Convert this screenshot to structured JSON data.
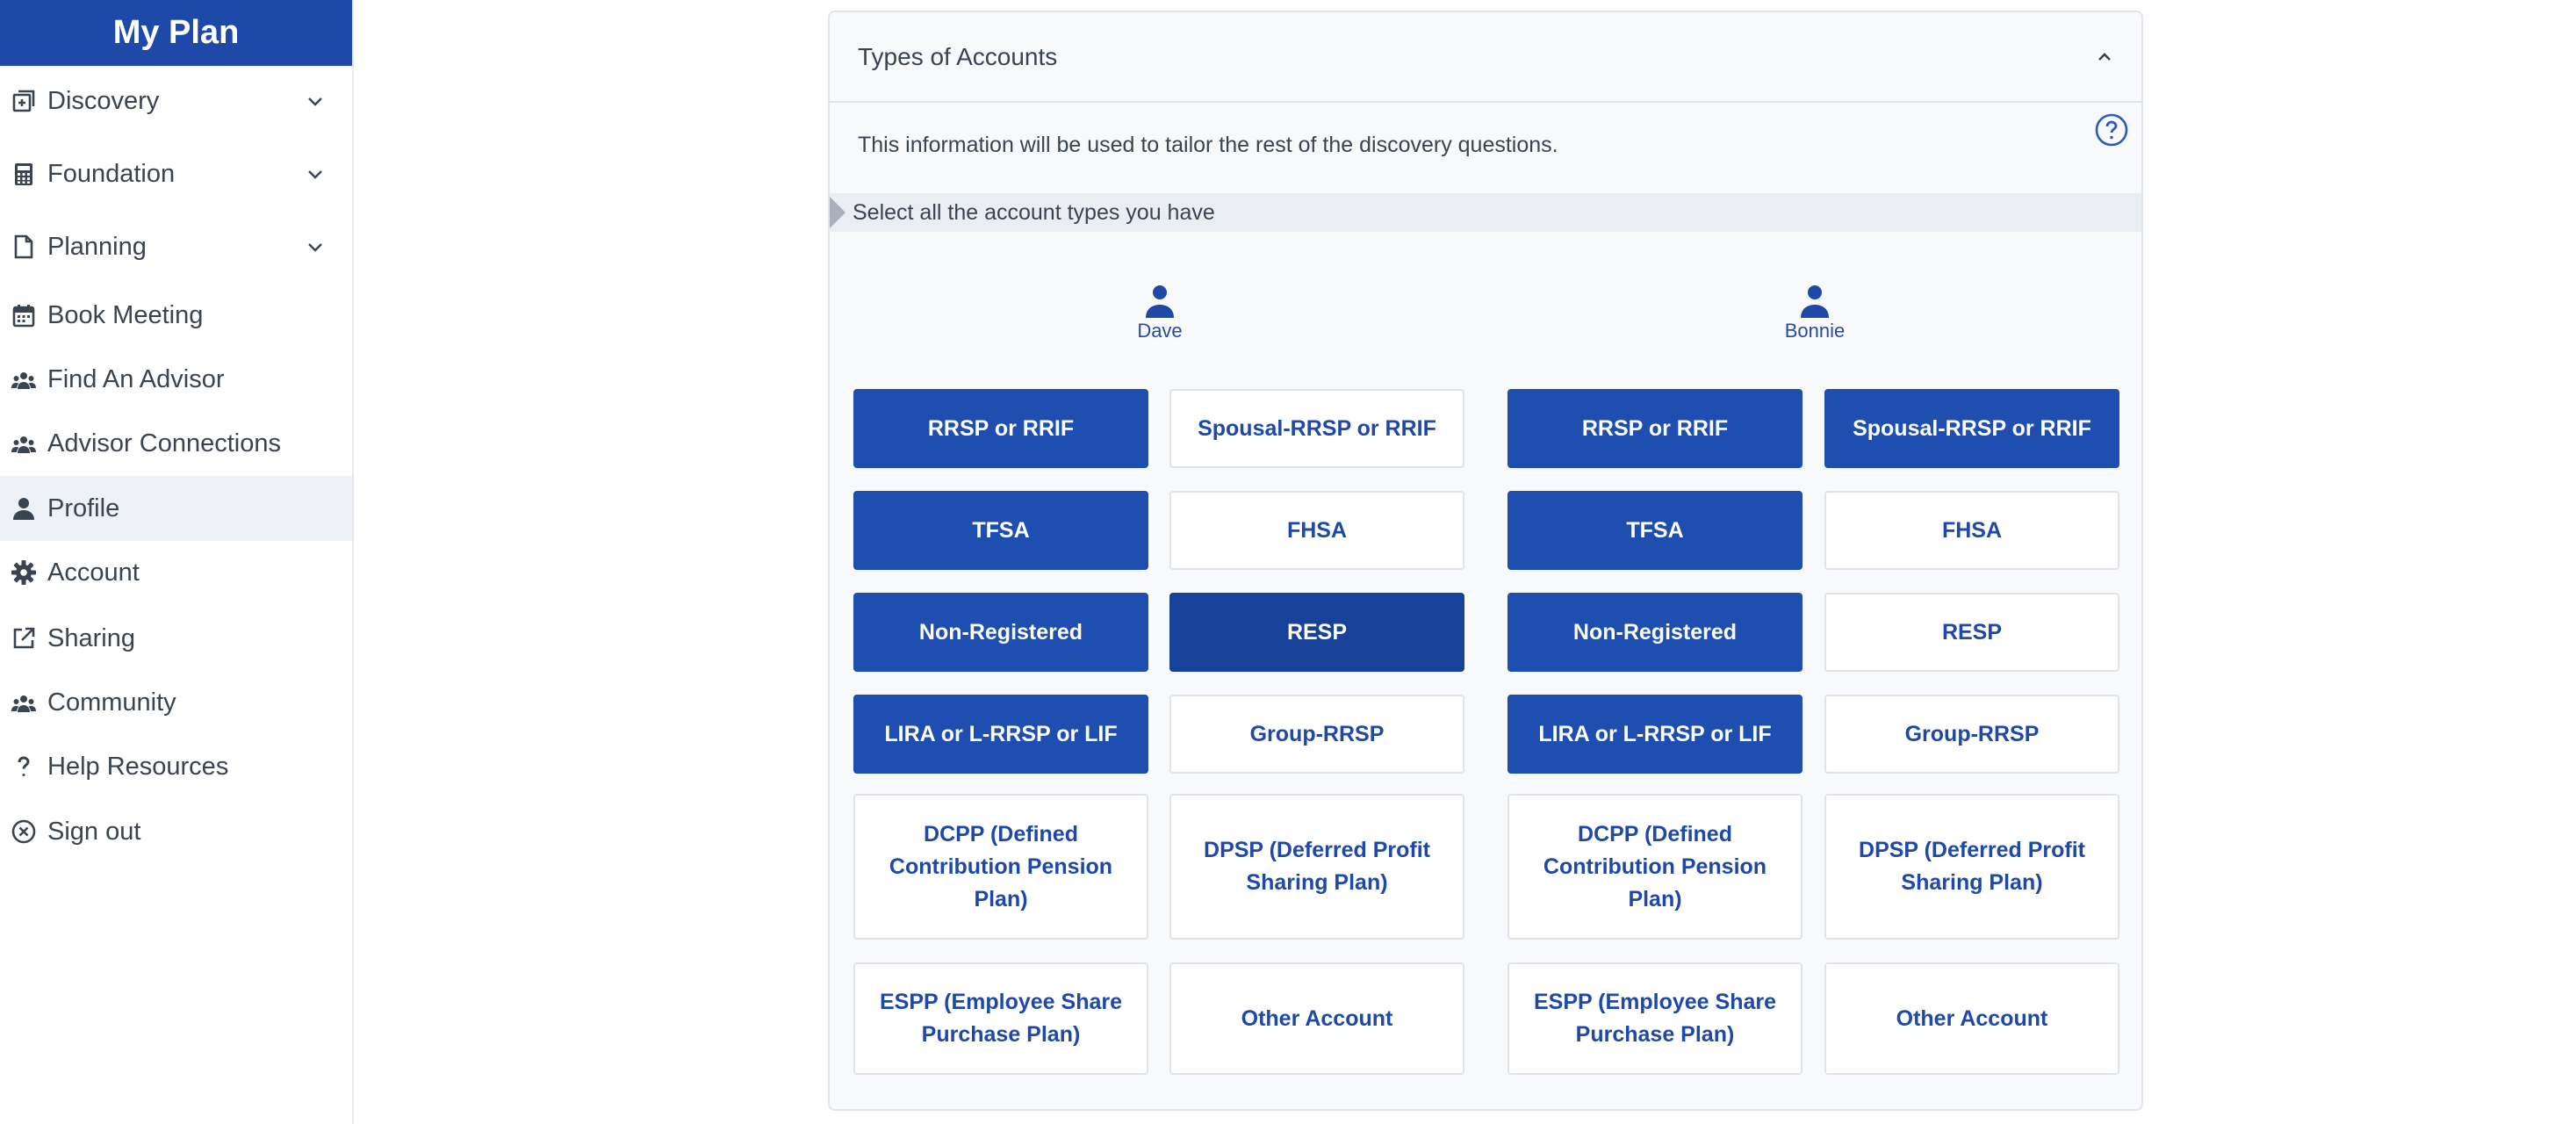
{
  "app": {
    "title": "My Plan"
  },
  "sidebar": {
    "items": [
      {
        "label": "Discovery",
        "icon": "discovery-icon",
        "expandable": true
      },
      {
        "label": "Foundation",
        "icon": "calculator-icon",
        "expandable": true
      },
      {
        "label": "Planning",
        "icon": "document-icon",
        "expandable": true
      },
      {
        "label": "Book Meeting",
        "icon": "calendar-icon",
        "expandable": false
      },
      {
        "label": "Find An Advisor",
        "icon": "group-icon",
        "expandable": false
      },
      {
        "label": "Advisor Connections",
        "icon": "group-icon",
        "expandable": false
      },
      {
        "label": "Profile",
        "icon": "user-icon",
        "expandable": false,
        "active": true
      },
      {
        "label": "Account",
        "icon": "gear-icon",
        "expandable": false
      },
      {
        "label": "Sharing",
        "icon": "external-link-icon",
        "expandable": false
      },
      {
        "label": "Community",
        "icon": "group-icon",
        "expandable": false
      },
      {
        "label": "Help Resources",
        "icon": "question-icon",
        "expandable": false
      },
      {
        "label": "Sign out",
        "icon": "close-circle-icon",
        "expandable": false
      }
    ]
  },
  "card": {
    "title": "Types of Accounts",
    "intro": "This information will be used to tailor the rest of the discovery questions.",
    "prompt": "Select all the account types you have"
  },
  "people": [
    {
      "name": "Dave",
      "accounts": [
        {
          "label": "RRSP or RRIF",
          "selected": true
        },
        {
          "label": "Spousal-RRSP or RRIF",
          "selected": false
        },
        {
          "label": "TFSA",
          "selected": true
        },
        {
          "label": "FHSA",
          "selected": false
        },
        {
          "label": "Non-Registered",
          "selected": true
        },
        {
          "label": "RESP",
          "selected": true,
          "focused": true
        },
        {
          "label": "LIRA or L-RRSP or LIF",
          "selected": true
        },
        {
          "label": "Group-RRSP",
          "selected": false
        },
        {
          "label": "DCPP (Defined Contribution Pension Plan)",
          "selected": false
        },
        {
          "label": "DPSP (Deferred Profit Sharing Plan)",
          "selected": false
        },
        {
          "label": "ESPP (Employee Share Purchase Plan)",
          "selected": false
        },
        {
          "label": "Other Account",
          "selected": false
        }
      ]
    },
    {
      "name": "Bonnie",
      "accounts": [
        {
          "label": "RRSP or RRIF",
          "selected": true
        },
        {
          "label": "Spousal-RRSP or RRIF",
          "selected": true
        },
        {
          "label": "TFSA",
          "selected": true
        },
        {
          "label": "FHSA",
          "selected": false
        },
        {
          "label": "Non-Registered",
          "selected": true
        },
        {
          "label": "RESP",
          "selected": false
        },
        {
          "label": "LIRA or L-RRSP or LIF",
          "selected": true
        },
        {
          "label": "Group-RRSP",
          "selected": false
        },
        {
          "label": "DCPP (Defined Contribution Pension Plan)",
          "selected": false
        },
        {
          "label": "DPSP (Deferred Profit Sharing Plan)",
          "selected": false
        },
        {
          "label": "ESPP (Employee Share Purchase Plan)",
          "selected": false
        },
        {
          "label": "Other Account",
          "selected": false
        }
      ]
    }
  ],
  "colors": {
    "brand": "#1e49a8",
    "selected": "#1e4fb0",
    "selected_focus": "#18419a",
    "unselected_text": "#1e49a8"
  }
}
